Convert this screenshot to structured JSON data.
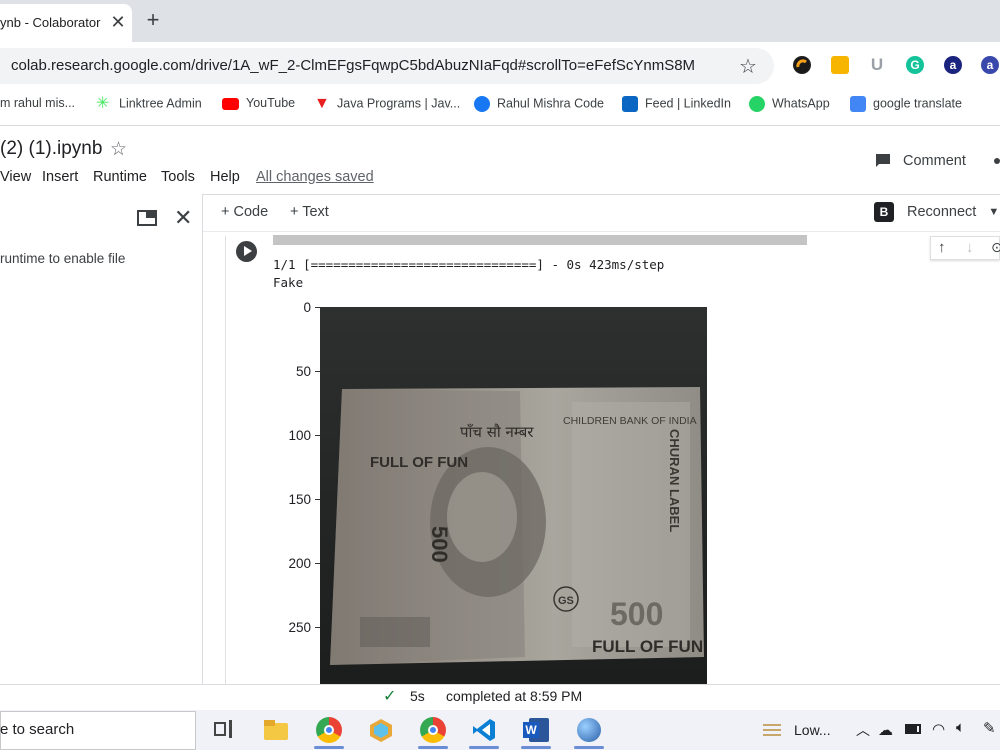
{
  "browser": {
    "tab_title": "ynb - Colaborator",
    "url": "colab.research.google.com/drive/1A_wF_2-ClmEFgsFqwpC5bdAbuzNIaFqd#scrollTo=eFefScYnmS8M",
    "bookmarks": [
      {
        "label": "m rahul mis...",
        "icon": "bookmark-icon",
        "color": "#5f6368"
      },
      {
        "label": "Linktree Admin",
        "icon": "linktree-icon",
        "color": "#43e660"
      },
      {
        "label": "YouTube",
        "icon": "youtube-icon",
        "color": "#ff0000"
      },
      {
        "label": "Java Programs | Jav...",
        "icon": "java-icon",
        "color": "#e91e1e"
      },
      {
        "label": "Rahul Mishra Code",
        "icon": "facebook-icon",
        "color": "#1877f2"
      },
      {
        "label": "Feed | LinkedIn",
        "icon": "linkedin-icon",
        "color": "#0a66c2"
      },
      {
        "label": "WhatsApp",
        "icon": "whatsapp-icon",
        "color": "#25d366"
      },
      {
        "label": "google translate",
        "icon": "translate-icon",
        "color": "#4285f4"
      }
    ]
  },
  "colab": {
    "notebook_title": "(2) (1).ipynb",
    "menu": [
      "View",
      "Insert",
      "Runtime",
      "Tools",
      "Help"
    ],
    "saved_status": "All changes saved",
    "comment_label": "Comment",
    "left_panel_message": "runtime to enable file",
    "add_code_label": "+ Code",
    "add_text_label": "+ Text",
    "reconnect_label": "Reconnect",
    "runtime_badge": "B",
    "output_line1": "1/1 [==============================] - 0s 423ms/step",
    "output_line2": "Fake",
    "image_axis_ticks": [
      "0",
      "50",
      "100",
      "150",
      "200",
      "250"
    ],
    "status_time": "5s",
    "status_text": "completed at 8:59 PM"
  },
  "banknote": {
    "denomination": "500",
    "bank_name": "CHILDREN BANK OF INDIA",
    "slogan": "FULL OF FUN",
    "side_text": "CHURAN LABEL",
    "mark": "GS",
    "hindi_text": "पाँच सौ नम्बर"
  },
  "taskbar": {
    "search_text": "e to search",
    "weather": "Low..."
  }
}
